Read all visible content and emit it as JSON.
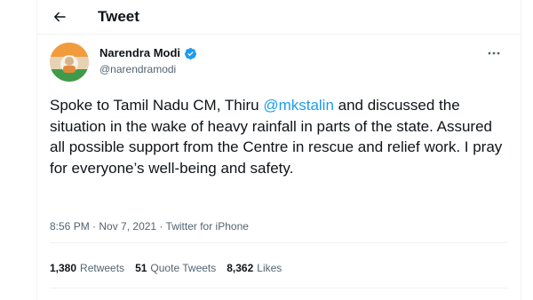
{
  "header": {
    "title": "Tweet"
  },
  "author": {
    "name": "Narendra Modi",
    "handle": "@narendramodi"
  },
  "tweet": {
    "text_before": "Spoke to Tamil Nadu CM, Thiru ",
    "mention": "@mkstalin",
    "text_after": " and discussed the situation in the wake of heavy rainfall in parts of the state. Assured all possible support from the Centre in rescue and relief work. I pray for everyone’s well-being and safety."
  },
  "meta": {
    "time": "8:56 PM",
    "separator": " · ",
    "date": "Nov 7, 2021",
    "source": "Twitter for iPhone"
  },
  "stats": {
    "retweets": {
      "count": "1,380",
      "label": "Retweets"
    },
    "quotes": {
      "count": "51",
      "label": "Quote Tweets"
    },
    "likes": {
      "count": "8,362",
      "label": "Likes"
    }
  },
  "colors": {
    "accent": "#1d9bf0",
    "text": "#0f1419",
    "secondary": "#536471",
    "border": "#eff3f4"
  },
  "icons": {
    "back": "arrow-left-icon",
    "verified": "verified-badge-icon",
    "more": "more-horizontal-icon"
  }
}
